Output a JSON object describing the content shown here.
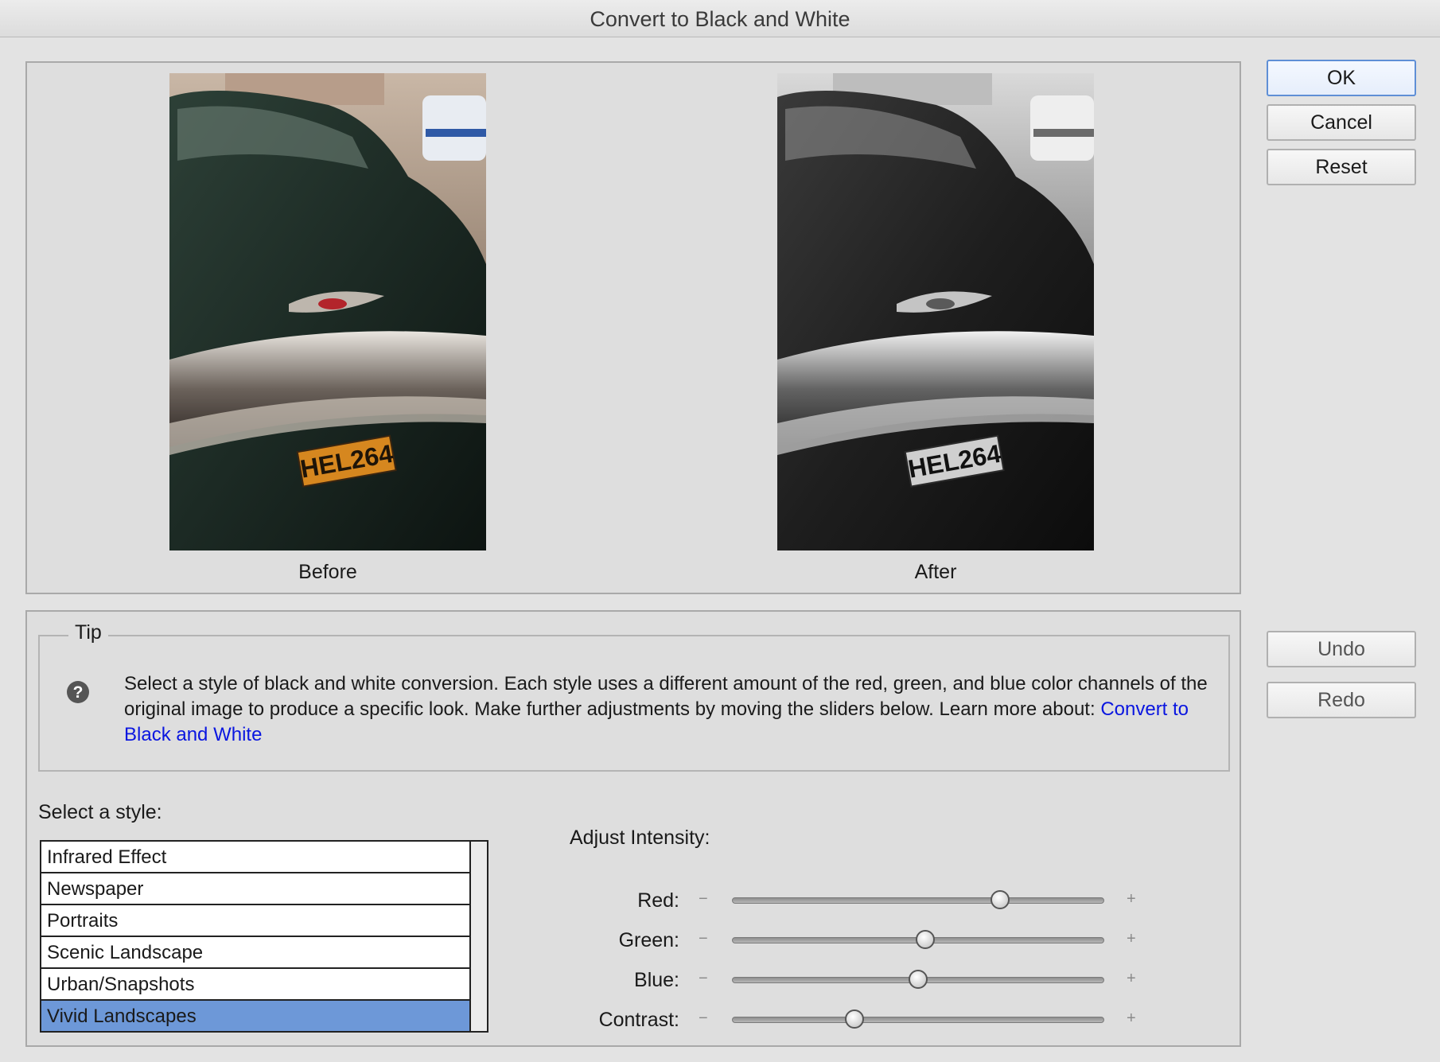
{
  "window": {
    "title": "Convert to Black and White"
  },
  "preview": {
    "before_label": "Before",
    "after_label": "After",
    "before_plate": "HEL264",
    "after_plate": "HEL264"
  },
  "buttons": {
    "ok": "OK",
    "cancel": "Cancel",
    "reset": "Reset",
    "undo": "Undo",
    "redo": "Redo"
  },
  "tip": {
    "title": "Tip",
    "icon": "question-icon",
    "text": "Select a style of black and white conversion. Each style uses a different amount of the red, green, and blue color channels of the original image to produce a specific look. Make further adjustments by moving the sliders below. Learn more about: ",
    "link": "Convert to Black and White"
  },
  "styles": {
    "label": "Select a style:",
    "items": [
      {
        "label": "Infrared Effect",
        "selected": false
      },
      {
        "label": "Newspaper",
        "selected": false
      },
      {
        "label": "Portraits",
        "selected": false
      },
      {
        "label": "Scenic Landscape",
        "selected": false
      },
      {
        "label": "Urban/Snapshots",
        "selected": false
      },
      {
        "label": "Vivid Landscapes",
        "selected": true
      }
    ]
  },
  "intensity": {
    "label": "Adjust Intensity:",
    "minus": "−",
    "plus": "+",
    "sliders": [
      {
        "label": "Red:",
        "value": 0.72
      },
      {
        "label": "Green:",
        "value": 0.52
      },
      {
        "label": "Blue:",
        "value": 0.5
      },
      {
        "label": "Contrast:",
        "value": 0.33
      }
    ]
  },
  "colors": {
    "selection": "#6d98d8",
    "link": "#0a16e0",
    "default_button_border": "#5f8fd6"
  }
}
